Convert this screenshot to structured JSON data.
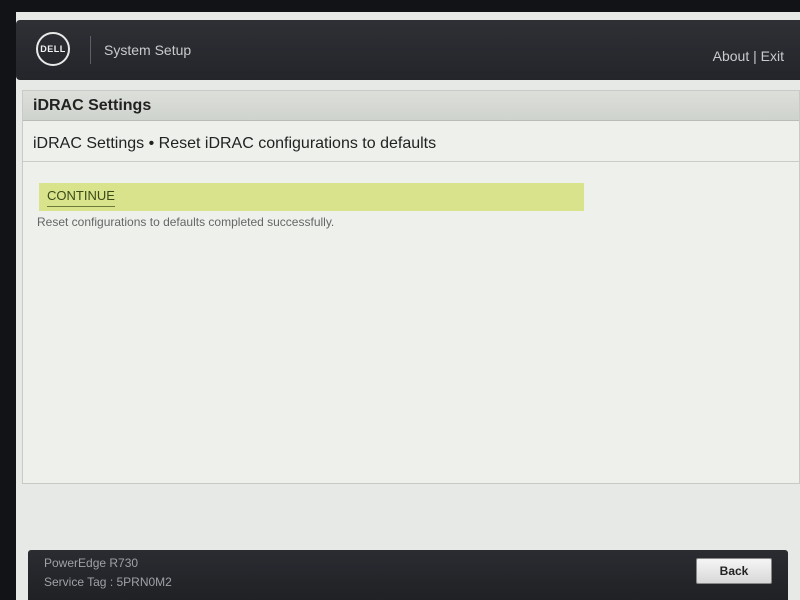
{
  "header": {
    "logo_text": "DELL",
    "app_title": "System Setup",
    "about_label": "About",
    "separator": "|",
    "exit_label": "Exit"
  },
  "panel": {
    "title": "iDRAC Settings",
    "breadcrumb": "iDRAC Settings • Reset iDRAC configurations to defaults",
    "continue_label": "CONTINUE",
    "status_message": "Reset configurations to defaults completed successfully."
  },
  "footer": {
    "model": "PowerEdge R730",
    "service_tag": "Service Tag : 5PRN0M2",
    "back_label": "Back"
  },
  "colors": {
    "topbar": "#2e3035",
    "highlight": "#d9e38c",
    "panel_bg": "#eef0ec"
  }
}
